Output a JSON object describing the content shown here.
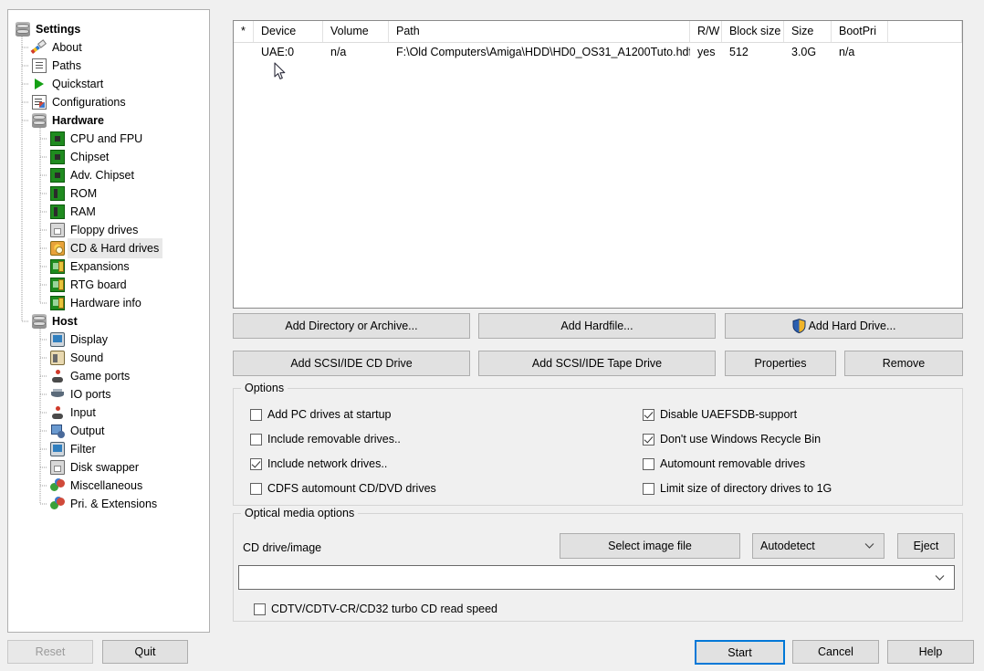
{
  "sidebar": {
    "items": [
      {
        "label": "Settings",
        "icon": "disk-stack-icon",
        "level": 0,
        "bold": true,
        "selected": false
      },
      {
        "label": "About",
        "icon": "pen-icon",
        "level": 1,
        "bold": false,
        "selected": false
      },
      {
        "label": "Paths",
        "icon": "document-icon",
        "level": 1,
        "bold": false,
        "selected": false
      },
      {
        "label": "Quickstart",
        "icon": "play-icon",
        "level": 1,
        "bold": false,
        "selected": false
      },
      {
        "label": "Configurations",
        "icon": "config-list-icon",
        "level": 1,
        "bold": false,
        "selected": false
      },
      {
        "label": "Hardware",
        "icon": "disk-stack-icon",
        "level": 1,
        "bold": true,
        "selected": false
      },
      {
        "label": "CPU and FPU",
        "icon": "chip-icon",
        "level": 2,
        "bold": false,
        "selected": false
      },
      {
        "label": "Chipset",
        "icon": "chip-icon",
        "level": 2,
        "bold": false,
        "selected": false
      },
      {
        "label": "Adv. Chipset",
        "icon": "chip-icon",
        "level": 2,
        "bold": false,
        "selected": false
      },
      {
        "label": "ROM",
        "icon": "ram-stick-icon",
        "level": 2,
        "bold": false,
        "selected": false
      },
      {
        "label": "RAM",
        "icon": "ram-stick-icon",
        "level": 2,
        "bold": false,
        "selected": false
      },
      {
        "label": "Floppy drives",
        "icon": "floppy-icon",
        "level": 2,
        "bold": false,
        "selected": false
      },
      {
        "label": "CD & Hard drives",
        "icon": "cd-harddrive-icon",
        "level": 2,
        "bold": false,
        "selected": true
      },
      {
        "label": "Expansions",
        "icon": "expansion-board-icon",
        "level": 2,
        "bold": false,
        "selected": false
      },
      {
        "label": "RTG board",
        "icon": "expansion-board-icon",
        "level": 2,
        "bold": false,
        "selected": false
      },
      {
        "label": "Hardware info",
        "icon": "expansion-board-icon",
        "level": 2,
        "bold": false,
        "selected": false
      },
      {
        "label": "Host",
        "icon": "disk-stack-icon",
        "level": 1,
        "bold": true,
        "selected": false
      },
      {
        "label": "Display",
        "icon": "monitor-icon",
        "level": 2,
        "bold": false,
        "selected": false
      },
      {
        "label": "Sound",
        "icon": "speaker-icon",
        "level": 2,
        "bold": false,
        "selected": false
      },
      {
        "label": "Game ports",
        "icon": "joystick-icon",
        "level": 2,
        "bold": false,
        "selected": false
      },
      {
        "label": "IO ports",
        "icon": "io-ports-icon",
        "level": 2,
        "bold": false,
        "selected": false
      },
      {
        "label": "Input",
        "icon": "joystick-icon",
        "level": 2,
        "bold": false,
        "selected": false
      },
      {
        "label": "Output",
        "icon": "output-icon",
        "level": 2,
        "bold": false,
        "selected": false
      },
      {
        "label": "Filter",
        "icon": "monitor-icon",
        "level": 2,
        "bold": false,
        "selected": false
      },
      {
        "label": "Disk swapper",
        "icon": "floppy-icon",
        "level": 2,
        "bold": false,
        "selected": false
      },
      {
        "label": "Miscellaneous",
        "icon": "spheres-icon",
        "level": 2,
        "bold": false,
        "selected": false
      },
      {
        "label": "Pri. & Extensions",
        "icon": "spheres-icon",
        "level": 2,
        "bold": false,
        "selected": false
      }
    ]
  },
  "drive_list": {
    "columns": [
      "*",
      "Device",
      "Volume",
      "Path",
      "R/W",
      "Block size",
      "Size",
      "BootPri"
    ],
    "rows": [
      {
        "star": "",
        "device": "UAE:0",
        "volume": "n/a",
        "path": "F:\\Old Computers\\Amiga\\HDD\\HD0_OS31_A1200Tuto.hdf",
        "rw": "yes",
        "block_size": "512",
        "size": "3.0G",
        "bootpri": "n/a"
      }
    ]
  },
  "actions": {
    "add_directory": "Add Directory or Archive...",
    "add_hardfile": "Add Hardfile...",
    "add_hard_drive": "Add Hard Drive...",
    "add_scsi_cd": "Add SCSI/IDE CD Drive",
    "add_scsi_tape": "Add SCSI/IDE Tape Drive",
    "properties": "Properties",
    "remove": "Remove"
  },
  "options": {
    "title": "Options",
    "left": [
      {
        "label": "Add PC drives at startup",
        "checked": false
      },
      {
        "label": "Include removable drives..",
        "checked": false
      },
      {
        "label": "Include network drives..",
        "checked": true
      },
      {
        "label": "CDFS automount CD/DVD drives",
        "checked": false
      }
    ],
    "right": [
      {
        "label": "Disable UAEFSDB-support",
        "checked": true
      },
      {
        "label": "Don't use Windows Recycle Bin",
        "checked": true
      },
      {
        "label": "Automount removable drives",
        "checked": false
      },
      {
        "label": "Limit size of directory drives to 1G",
        "checked": false
      }
    ]
  },
  "optical": {
    "title": "Optical media options",
    "cd_label": "CD drive/image",
    "select_image_button": "Select image file",
    "mode_selected": "Autodetect",
    "eject_button": "Eject",
    "image_path_value": "",
    "turbo": {
      "label": "CDTV/CDTV-CR/CD32 turbo CD read speed",
      "checked": false
    }
  },
  "footer": {
    "reset": "Reset",
    "quit": "Quit",
    "start": "Start",
    "cancel": "Cancel",
    "help": "Help"
  },
  "colors": {
    "window_bg": "#f0f0f0",
    "accent_focus": "#0078d7",
    "button_face": "#e1e1e1",
    "shield_blue": "#2a5fb0",
    "shield_gold": "#f0b429"
  }
}
